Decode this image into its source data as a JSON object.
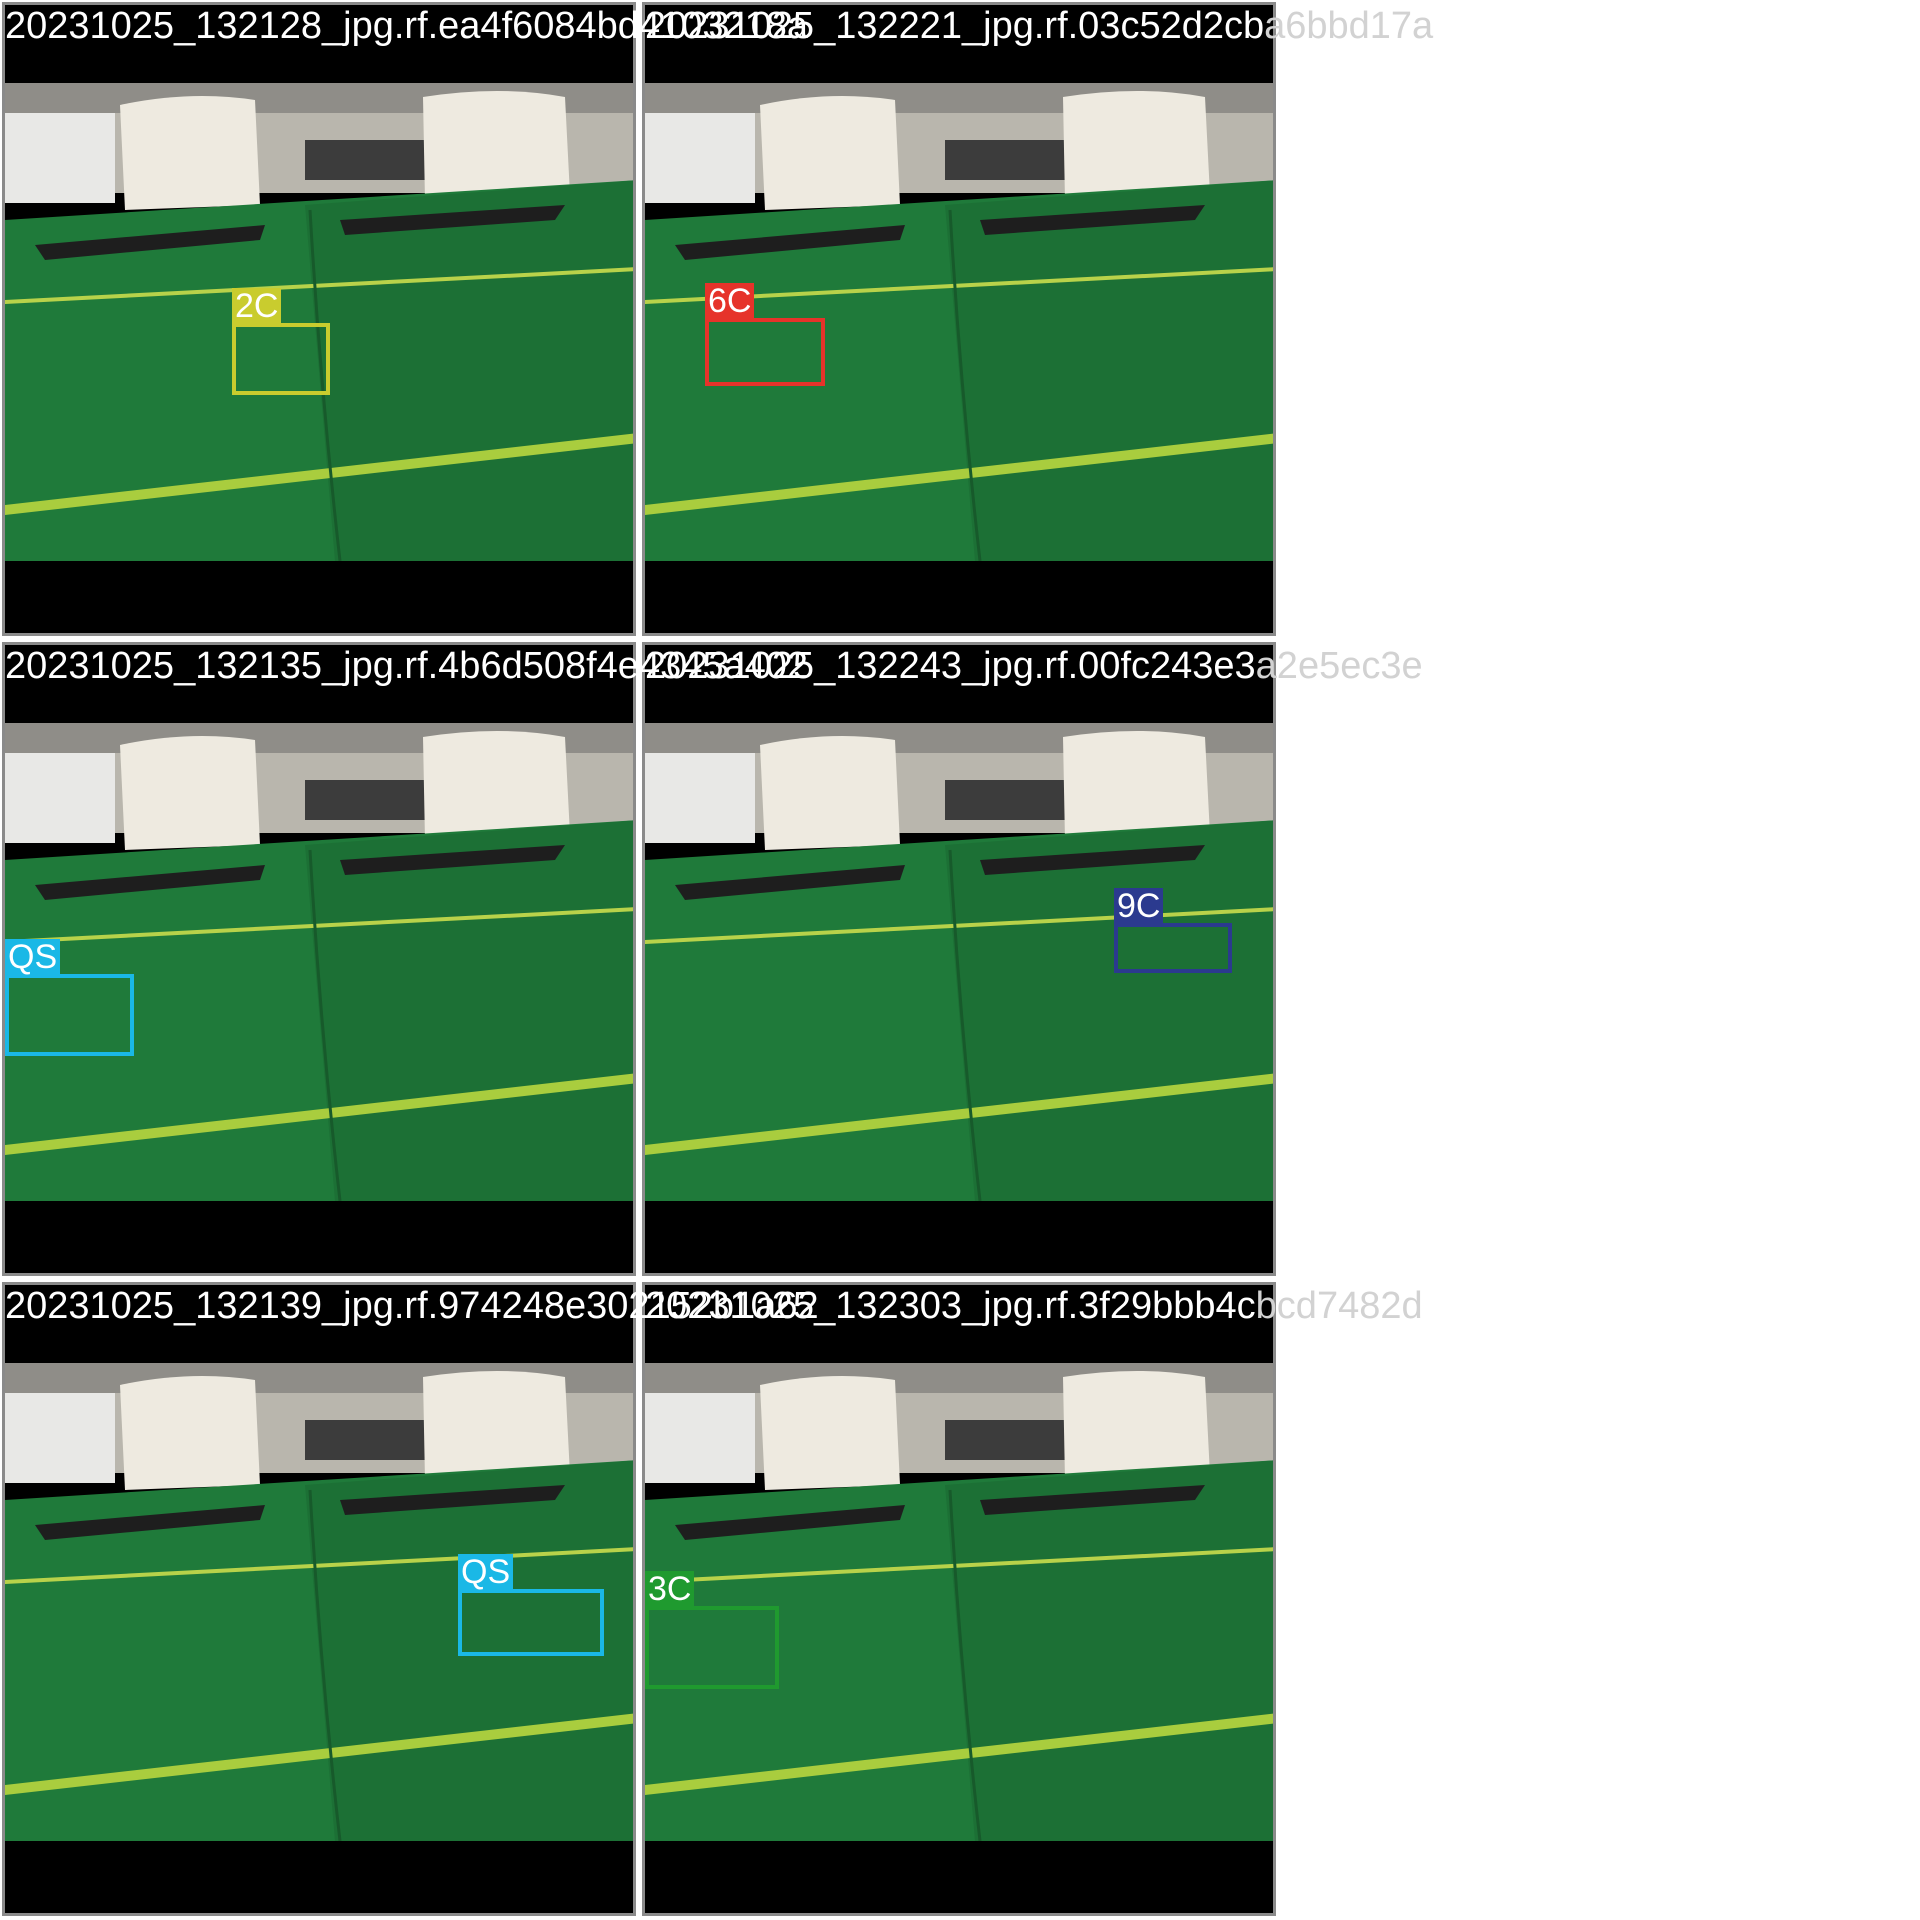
{
  "tiles": [
    {
      "filename": "20231025_132128_jpg.rf.ea4f6084bd4103218a",
      "label": "2C",
      "color": "#c9cc2e"
    },
    {
      "filename": "20231025_132221_jpg.rf.03c52d2cba6bbd17a",
      "label": "6C",
      "color": "#e6332a"
    },
    {
      "filename": "20231025_132135_jpg.rf.4b6d508f4e4345a402",
      "label": "QS",
      "color": "#1ab8e6"
    },
    {
      "filename": "20231025_132243_jpg.rf.00fc243e3a2e5ec3e",
      "label": "9C",
      "color": "#2b3a8f"
    },
    {
      "filename": "20231025_132139_jpg.rf.974248e302152b1a62",
      "label": "QS",
      "color": "#1ab8e6"
    },
    {
      "filename": "20231025_132303_jpg.rf.3f29bbb4cbcd7482d",
      "label": "3C",
      "color": "#1f9a2f"
    }
  ]
}
